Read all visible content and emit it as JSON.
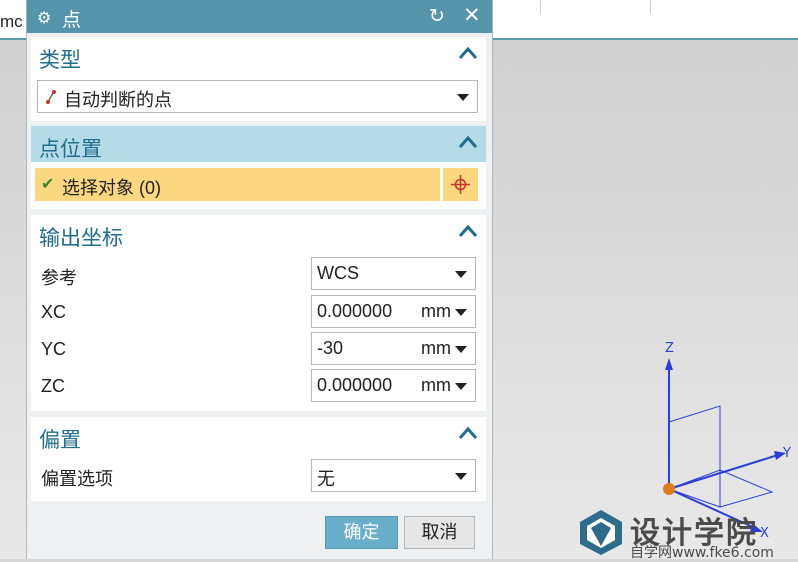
{
  "background_app": {
    "tab_text": "mc"
  },
  "dialog": {
    "title": "点",
    "icons": {
      "settings": "gear-icon",
      "reset": "reset-icon",
      "close": "close-icon"
    },
    "type_section": {
      "title": "类型",
      "selected": "自动判断的点"
    },
    "position_section": {
      "title": "点位置",
      "select_object": "选择对象 (0)"
    },
    "output_section": {
      "title": "输出坐标",
      "reference_label": "参考",
      "reference_value": "WCS",
      "xc_label": "XC",
      "xc_value": "0.000000",
      "xc_unit": "mm",
      "yc_label": "YC",
      "yc_value": "-30",
      "yc_unit": "mm",
      "zc_label": "ZC",
      "zc_value": "0.000000",
      "zc_unit": "mm"
    },
    "offset_section": {
      "title": "偏置",
      "option_label": "偏置选项",
      "option_value": "无"
    },
    "buttons": {
      "ok": "确定",
      "cancel": "取消"
    }
  },
  "viewport": {
    "axes": {
      "x": "X",
      "y": "Y",
      "z": "Z"
    }
  },
  "watermark": {
    "title": "设计学院",
    "subtitle": "自学网www.fke6.com"
  },
  "colors": {
    "titlebar": "#5595ab",
    "section_title": "#1f6e8b",
    "highlight": "#fbd77f",
    "ok_button": "#69afcb",
    "axis_blue": "#2a3fd6",
    "origin": "#e07a1f"
  }
}
